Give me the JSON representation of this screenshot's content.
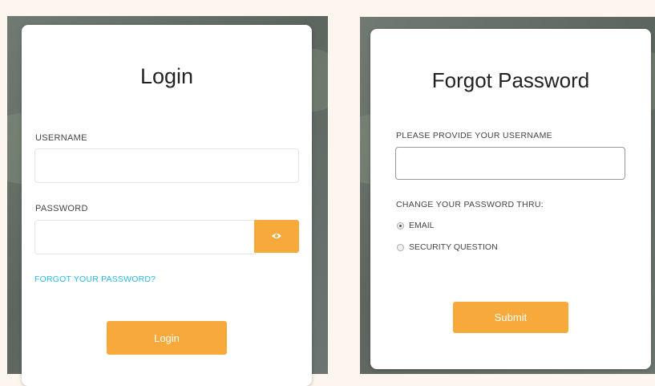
{
  "login": {
    "title": "Login",
    "username_label": "USERNAME",
    "username_value": "",
    "password_label": "PASSWORD",
    "password_value": "",
    "reveal_icon": "eye-icon",
    "forgot_link": "FORGOT YOUR PASSWORD?",
    "submit_label": "Login"
  },
  "forgot": {
    "title": "Forgot Password",
    "username_label": "PLEASE PROVIDE YOUR USERNAME",
    "username_value": "",
    "method_label": "CHANGE YOUR PASSWORD THRU:",
    "options": [
      {
        "label": "EMAIL",
        "checked": true
      },
      {
        "label": "SECURITY QUESTION",
        "checked": false
      }
    ],
    "submit_label": "Submit"
  },
  "colors": {
    "accent": "#f7a93b",
    "link": "#2ab7e3",
    "page_background": "#fdf6ef",
    "panel_background": "#656d67"
  }
}
